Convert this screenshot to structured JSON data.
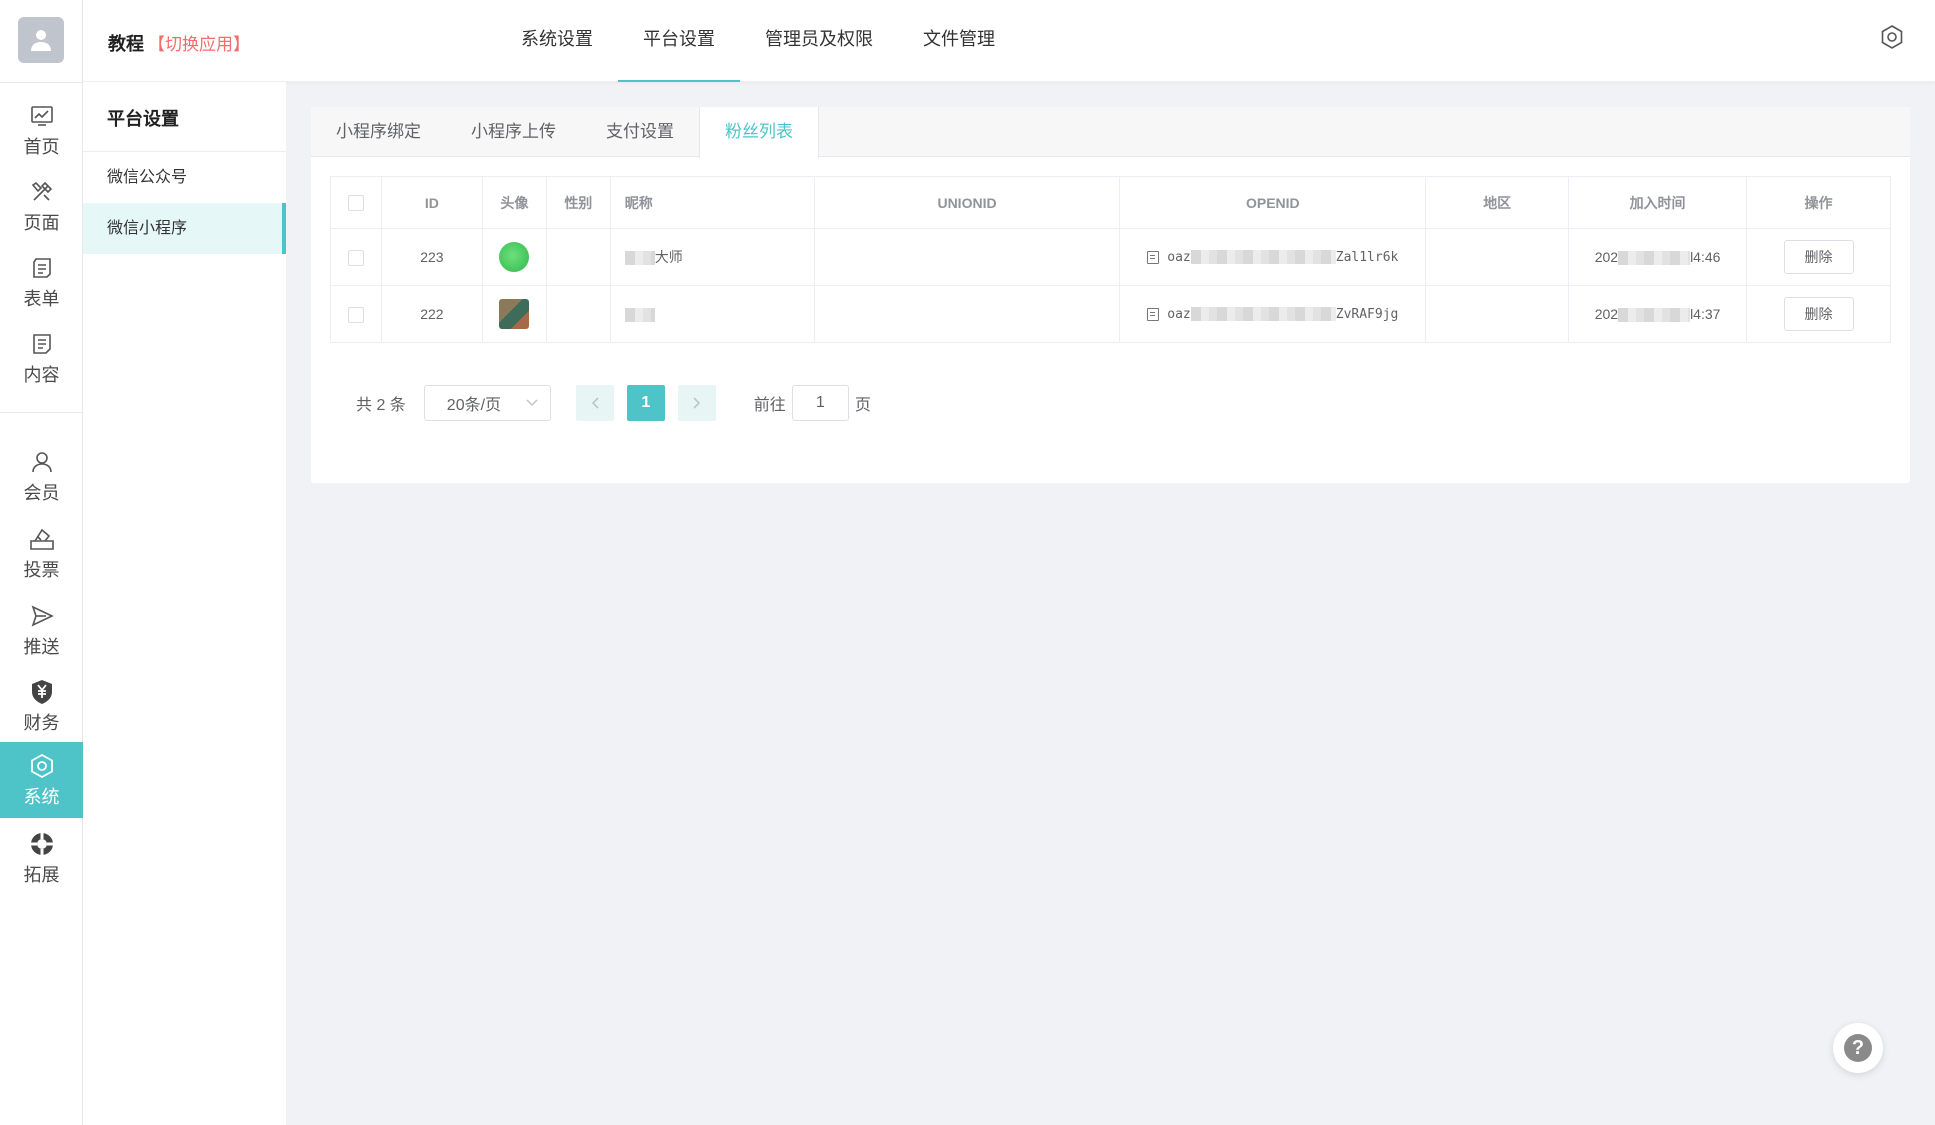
{
  "rail": {
    "items": [
      {
        "label": "首页",
        "icon": "chart-line-icon"
      },
      {
        "label": "页面",
        "icon": "tools-icon"
      },
      {
        "label": "表单",
        "icon": "form-icon"
      },
      {
        "label": "内容",
        "icon": "content-icon"
      },
      {
        "label": "会员",
        "icon": "user-icon"
      },
      {
        "label": "投票",
        "icon": "vote-icon"
      },
      {
        "label": "推送",
        "icon": "send-icon"
      },
      {
        "label": "财务",
        "icon": "yen-shield-icon"
      },
      {
        "label": "系统",
        "icon": "hexagon-gear-icon"
      },
      {
        "label": "拓展",
        "icon": "extension-icon"
      }
    ],
    "active": "系统"
  },
  "header": {
    "brand": "教程",
    "switch_app": "【切换应用】",
    "nav": [
      "系统设置",
      "平台设置",
      "管理员及权限",
      "文件管理"
    ],
    "active_nav": "平台设置",
    "settings_icon": "gear-icon"
  },
  "subside": {
    "title": "平台设置",
    "items": [
      "微信公众号",
      "微信小程序"
    ],
    "active": "微信小程序"
  },
  "tabs": {
    "items": [
      "小程序绑定",
      "小程序上传",
      "支付设置",
      "粉丝列表"
    ],
    "active": "粉丝列表"
  },
  "table": {
    "columns": [
      "ID",
      "头像",
      "性别",
      "昵称",
      "UNIONID",
      "OPENID",
      "地区",
      "加入时间",
      "操作"
    ],
    "rows": [
      {
        "id": "223",
        "nickname_suffix": "大师",
        "openid_prefix": "oaz",
        "openid_suffix": "Zal1lr6k",
        "time_prefix": "202",
        "time_suffix": "l4:46",
        "action": "删除"
      },
      {
        "id": "222",
        "nickname_suffix": "",
        "openid_prefix": "oaz",
        "openid_suffix": "ZvRAF9jg",
        "time_prefix": "202",
        "time_suffix": "l4:37",
        "action": "删除"
      }
    ]
  },
  "pager": {
    "total": "共 2 条",
    "page_size": "20条/页",
    "current": "1",
    "goto_label": "前往",
    "goto_value": "1",
    "page_unit": "页"
  },
  "colors": {
    "accent": "#4fc4c8",
    "switch_red": "#f56c6c"
  }
}
